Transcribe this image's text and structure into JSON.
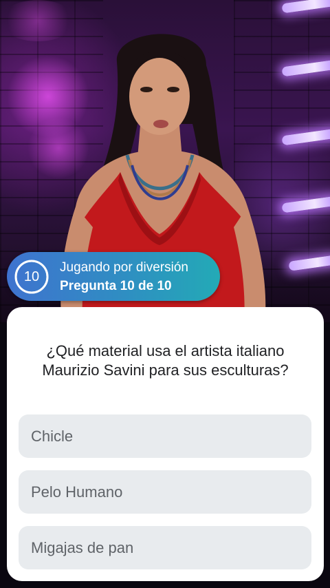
{
  "status": {
    "question_number": "10",
    "mode_label": "Jugando por diversión",
    "progress_label": "Pregunta 10 de 10",
    "progress_fraction": 1.0,
    "ring_color": "#ffffff",
    "gradient_start": "#3f73cf",
    "gradient_end": "#23aab6"
  },
  "question": {
    "text": "¿Qué material usa el artista italiano Maurizio Savini para sus esculturas?"
  },
  "answers": [
    {
      "label": "Chicle"
    },
    {
      "label": "Pelo Humano"
    },
    {
      "label": "Migajas de pan"
    }
  ],
  "video": {
    "scene": "presenter-in-red-dress"
  }
}
